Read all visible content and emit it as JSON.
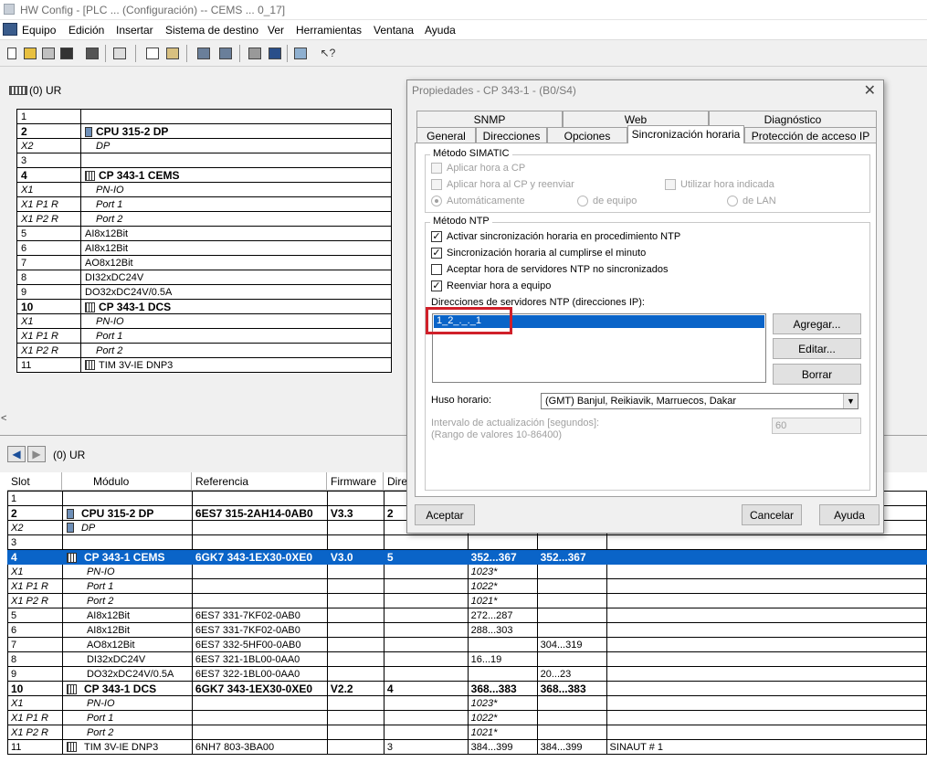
{
  "window": {
    "title": "HW Config - [PLC ... (Configuración) -- CEMS ... 0_17]"
  },
  "menu": [
    "Equipo",
    "Edición",
    "Insertar",
    "Sistema de destino",
    "Ver",
    "Herramientas",
    "Ventana",
    "Ayuda"
  ],
  "toolbar_icons": [
    "new-icon",
    "open-icon",
    "network-icon",
    "save-icon",
    "save-compile-icon",
    "print-icon",
    "copy-icon",
    "paste-icon",
    "download-icon",
    "upload-icon",
    "catalog-icon",
    "view-icon",
    "netpro-icon",
    "help-context-icon"
  ],
  "station": {
    "title": "(0) UR",
    "rows": [
      {
        "slot": "1",
        "module": "",
        "bold": false,
        "italic": false,
        "icon": ""
      },
      {
        "slot": "2",
        "module": "CPU 315-2 DP",
        "bold": true,
        "italic": false,
        "icon": "cpu"
      },
      {
        "slot": "X2",
        "module": "DP",
        "bold": false,
        "italic": true,
        "icon": ""
      },
      {
        "slot": "3",
        "module": "",
        "bold": false,
        "italic": false,
        "icon": ""
      },
      {
        "slot": "4",
        "module": "CP 343-1 CEMS",
        "bold": true,
        "italic": false,
        "icon": "cp"
      },
      {
        "slot": "X1",
        "module": "PN-IO",
        "bold": false,
        "italic": true,
        "icon": ""
      },
      {
        "slot": "X1 P1 R",
        "module": "Port 1",
        "bold": false,
        "italic": true,
        "icon": ""
      },
      {
        "slot": "X1 P2 R",
        "module": "Port 2",
        "bold": false,
        "italic": true,
        "icon": ""
      },
      {
        "slot": "5",
        "module": "AI8x12Bit",
        "bold": false,
        "italic": false,
        "icon": ""
      },
      {
        "slot": "6",
        "module": "AI8x12Bit",
        "bold": false,
        "italic": false,
        "icon": ""
      },
      {
        "slot": "7",
        "module": "AO8x12Bit",
        "bold": false,
        "italic": false,
        "icon": ""
      },
      {
        "slot": "8",
        "module": "DI32xDC24V",
        "bold": false,
        "italic": false,
        "icon": ""
      },
      {
        "slot": "9",
        "module": "DO32xDC24V/0.5A",
        "bold": false,
        "italic": false,
        "icon": ""
      },
      {
        "slot": "10",
        "module": "CP 343-1 DCS",
        "bold": true,
        "italic": false,
        "icon": "cp"
      },
      {
        "slot": "X1",
        "module": "PN-IO",
        "bold": false,
        "italic": true,
        "icon": ""
      },
      {
        "slot": "X1 P1 R",
        "module": "Port 1",
        "bold": false,
        "italic": true,
        "icon": ""
      },
      {
        "slot": "X1 P2 R",
        "module": "Port 2",
        "bold": false,
        "italic": true,
        "icon": ""
      },
      {
        "slot": "11",
        "module": "TIM 3V-IE DNP3",
        "bold": false,
        "italic": false,
        "icon": "cp"
      }
    ]
  },
  "detail": {
    "title": "(0)   UR",
    "columns": [
      "Slot",
      "Módulo",
      "Referencia",
      "Firmware",
      "Dire"
    ],
    "rows": [
      {
        "slot": "1",
        "module": "",
        "ref": "",
        "fw": "",
        "addr": "",
        "e": "",
        "a": "",
        "comment": "",
        "bold": false,
        "italic": false,
        "sel": false,
        "icon": ""
      },
      {
        "slot": "2",
        "module": "CPU 315-2 DP",
        "ref": "6ES7 315-2AH14-0AB0",
        "fw": "V3.3",
        "addr": "2",
        "e": "",
        "a": "",
        "comment": "",
        "bold": true,
        "italic": false,
        "sel": false,
        "icon": "cpu"
      },
      {
        "slot": "X2",
        "module": "DP",
        "ref": "",
        "fw": "",
        "addr": "",
        "e": "",
        "a": "",
        "comment": "",
        "bold": false,
        "italic": true,
        "sel": false,
        "icon": "cpu"
      },
      {
        "slot": "3",
        "module": "",
        "ref": "",
        "fw": "",
        "addr": "",
        "e": "",
        "a": "",
        "comment": "",
        "bold": false,
        "italic": false,
        "sel": false,
        "icon": ""
      },
      {
        "slot": "4",
        "module": "CP 343-1 CEMS",
        "ref": "6GK7 343-1EX30-0XE0",
        "fw": "V3.0",
        "addr": "5",
        "e": "352...367",
        "a": "352...367",
        "comment": "",
        "bold": true,
        "italic": false,
        "sel": true,
        "icon": "cp"
      },
      {
        "slot": "X1",
        "module": "PN-IO",
        "ref": "",
        "fw": "",
        "addr": "",
        "e": "1023*",
        "a": "",
        "comment": "",
        "bold": false,
        "italic": true,
        "sel": false,
        "icon": ""
      },
      {
        "slot": "X1 P1 R",
        "module": "Port 1",
        "ref": "",
        "fw": "",
        "addr": "",
        "e": "1022*",
        "a": "",
        "comment": "",
        "bold": false,
        "italic": true,
        "sel": false,
        "icon": ""
      },
      {
        "slot": "X1 P2 R",
        "module": "Port 2",
        "ref": "",
        "fw": "",
        "addr": "",
        "e": "1021*",
        "a": "",
        "comment": "",
        "bold": false,
        "italic": true,
        "sel": false,
        "icon": ""
      },
      {
        "slot": "5",
        "module": "AI8x12Bit",
        "ref": "6ES7 331-7KF02-0AB0",
        "fw": "",
        "addr": "",
        "e": "272...287",
        "a": "",
        "comment": "",
        "bold": false,
        "italic": false,
        "sel": false,
        "icon": ""
      },
      {
        "slot": "6",
        "module": "AI8x12Bit",
        "ref": "6ES7 331-7KF02-0AB0",
        "fw": "",
        "addr": "",
        "e": "288...303",
        "a": "",
        "comment": "",
        "bold": false,
        "italic": false,
        "sel": false,
        "icon": ""
      },
      {
        "slot": "7",
        "module": "AO8x12Bit",
        "ref": "6ES7 332-5HF00-0AB0",
        "fw": "",
        "addr": "",
        "e": "",
        "a": "304...319",
        "comment": "",
        "bold": false,
        "italic": false,
        "sel": false,
        "icon": ""
      },
      {
        "slot": "8",
        "module": "DI32xDC24V",
        "ref": "6ES7 321-1BL00-0AA0",
        "fw": "",
        "addr": "",
        "e": "16...19",
        "a": "",
        "comment": "",
        "bold": false,
        "italic": false,
        "sel": false,
        "icon": ""
      },
      {
        "slot": "9",
        "module": "DO32xDC24V/0.5A",
        "ref": "6ES7 322-1BL00-0AA0",
        "fw": "",
        "addr": "",
        "e": "",
        "a": "20...23",
        "comment": "",
        "bold": false,
        "italic": false,
        "sel": false,
        "icon": ""
      },
      {
        "slot": "10",
        "module": "CP 343-1 DCS",
        "ref": "6GK7 343-1EX30-0XE0",
        "fw": "V2.2",
        "addr": "4",
        "e": "368...383",
        "a": "368...383",
        "comment": "",
        "bold": true,
        "italic": false,
        "sel": false,
        "icon": "cp"
      },
      {
        "slot": "X1",
        "module": "PN-IO",
        "ref": "",
        "fw": "",
        "addr": "",
        "e": "1023*",
        "a": "",
        "comment": "",
        "bold": false,
        "italic": true,
        "sel": false,
        "icon": ""
      },
      {
        "slot": "X1 P1 R",
        "module": "Port 1",
        "ref": "",
        "fw": "",
        "addr": "",
        "e": "1022*",
        "a": "",
        "comment": "",
        "bold": false,
        "italic": true,
        "sel": false,
        "icon": ""
      },
      {
        "slot": "X1 P2 R",
        "module": "Port 2",
        "ref": "",
        "fw": "",
        "addr": "",
        "e": "1021*",
        "a": "",
        "comment": "",
        "bold": false,
        "italic": true,
        "sel": false,
        "icon": ""
      },
      {
        "slot": "11",
        "module": "TIM 3V-IE DNP3",
        "ref": "6NH7 803-3BA00",
        "fw": "",
        "addr": "3",
        "e": "384...399",
        "a": "384...399",
        "comment": "SINAUT # 1",
        "bold": false,
        "italic": false,
        "sel": false,
        "icon": "cp"
      }
    ]
  },
  "dialog": {
    "title": "Propiedades - CP 343-1 - (B0/S4)",
    "tabs_row1": [
      "SNMP",
      "Web",
      "Diagnóstico"
    ],
    "tabs_row2": [
      "General",
      "Direcciones",
      "Opciones",
      "Sincronización horaria",
      "Protección de acceso IP"
    ],
    "simatic": {
      "label": "Método SIMATIC",
      "apply_cp": "Aplicar hora a CP",
      "apply_forward": "Aplicar hora al CP y reenviar",
      "use_indicated": "Utilizar hora indicada",
      "auto": "Automáticamente",
      "from_station": "de equipo",
      "from_lan": "de LAN"
    },
    "ntp": {
      "label": "Método NTP",
      "opt1": {
        "text": "Activar sincronización horaria en procedimiento NTP",
        "checked": true
      },
      "opt2": {
        "text": "Sincronización horaria al cumplirse el minuto",
        "checked": true
      },
      "opt3": {
        "text": "Aceptar hora de servidores NTP no sincronizados",
        "checked": false
      },
      "opt4": {
        "text": "Reenviar hora a equipo",
        "checked": true
      },
      "servers_label": "Direcciones de servidores NTP (direcciones IP):",
      "server_entry": "1_2_._._1",
      "add": "Agregar...",
      "edit": "Editar...",
      "delete": "Borrar",
      "tz_label": "Huso horario:",
      "tz_value": "(GMT) Banjul, Reikiavik, Marruecos, Dakar",
      "interval_label_1": "Intervalo de actualización [segundos]:",
      "interval_label_2": "(Rango de valores 10-86400)",
      "interval_value": "60"
    },
    "ok": "Aceptar",
    "cancel": "Cancelar",
    "help": "Ayuda"
  }
}
